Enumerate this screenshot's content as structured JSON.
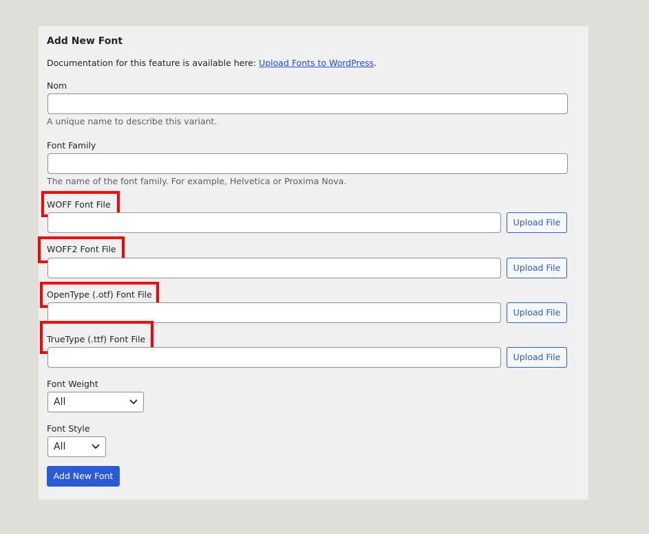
{
  "form": {
    "title": "Add New Font",
    "doc_text": "Documentation for this feature is available here: ",
    "doc_link": "Upload Fonts to WordPress",
    "doc_suffix": ".",
    "name_label": "Nom",
    "name_value": "",
    "name_hint": "A unique name to describe this variant.",
    "family_label": "Font Family",
    "family_value": "",
    "family_hint": "The name of the font family. For example, Helvetica or Proxima Nova.",
    "woff_label": "WOFF Font File",
    "woff2_label": "WOFF2 Font File",
    "otf_label": "OpenType (.otf) Font File",
    "ttf_label": "TrueType (.ttf) Font File",
    "upload_label": "Upload File",
    "weight_label": "Font Weight",
    "weight_value": "All",
    "style_label": "Font Style",
    "style_value": "All",
    "submit_label": "Add New Font"
  },
  "colors": {
    "accent": "#2a5bd7",
    "link": "#2249d6",
    "highlight": "#ff0000",
    "panel_bg": "#f0f0f1",
    "page_bg": "#dfded9"
  }
}
